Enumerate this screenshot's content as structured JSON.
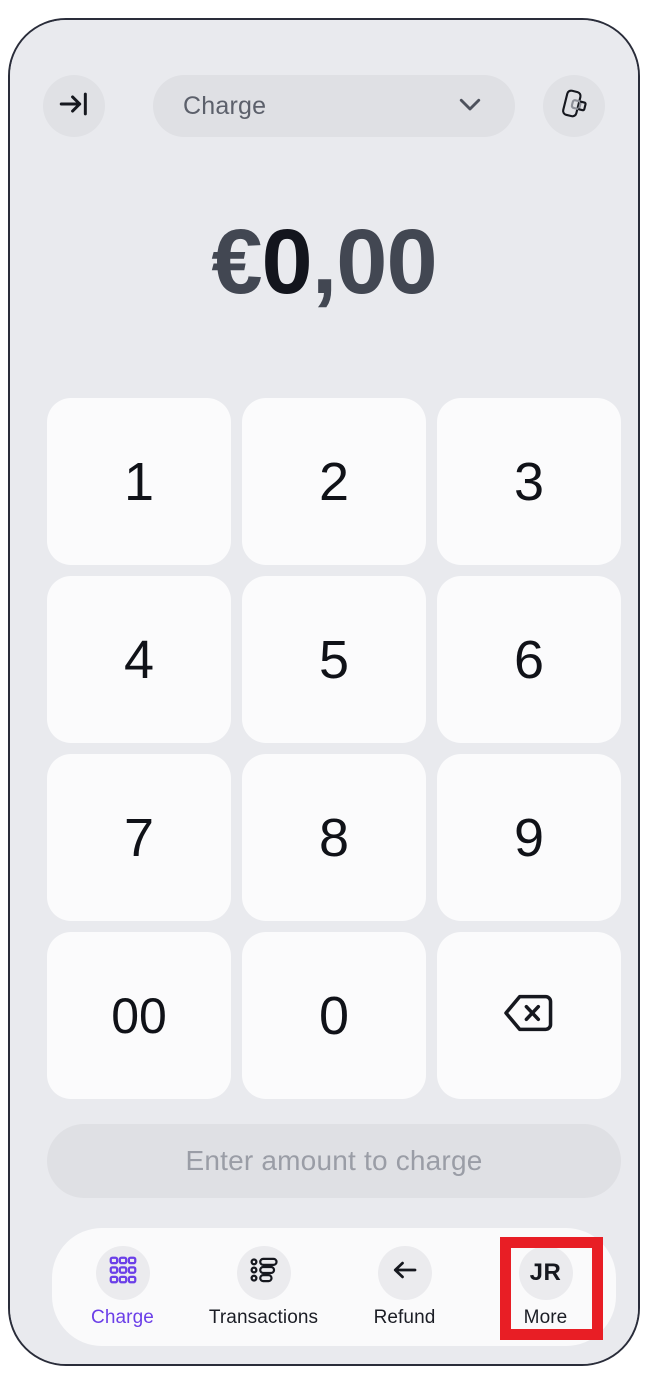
{
  "app": {
    "background_color": "#e9eaee",
    "accent_color": "#6b3fe8",
    "annotation_color": "#e81e25"
  },
  "top_bar": {
    "exit_icon": "arrow-right-to-bar-icon",
    "tap_to_pay_icon": "tap-to-pay-phone-icon",
    "mode_selector": {
      "value": "Charge",
      "chevron_icon": "chevron-down-icon"
    }
  },
  "amount": {
    "currency": "€",
    "integer_part": "0",
    "decimal_part": ",00",
    "full": "€0,00"
  },
  "keypad": {
    "keys": [
      {
        "label": "1",
        "name": "key-1"
      },
      {
        "label": "2",
        "name": "key-2"
      },
      {
        "label": "3",
        "name": "key-3"
      },
      {
        "label": "4",
        "name": "key-4"
      },
      {
        "label": "5",
        "name": "key-5"
      },
      {
        "label": "6",
        "name": "key-6"
      },
      {
        "label": "7",
        "name": "key-7"
      },
      {
        "label": "8",
        "name": "key-8"
      },
      {
        "label": "9",
        "name": "key-9"
      },
      {
        "label": "00",
        "name": "key-double-zero"
      },
      {
        "label": "0",
        "name": "key-0"
      },
      {
        "label": "",
        "name": "key-backspace",
        "icon": "backspace-icon"
      }
    ]
  },
  "charge_cta": {
    "label": "Enter amount to charge",
    "enabled": false
  },
  "bottom_nav": {
    "items": [
      {
        "label": "Charge",
        "icon": "grid-keypad-icon",
        "active": true
      },
      {
        "label": "Transactions",
        "icon": "list-icon",
        "active": false
      },
      {
        "label": "Refund",
        "icon": "arrow-left-icon",
        "active": false
      },
      {
        "label": "More",
        "icon": "avatar-initials",
        "initials": "JR",
        "active": false
      }
    ]
  }
}
